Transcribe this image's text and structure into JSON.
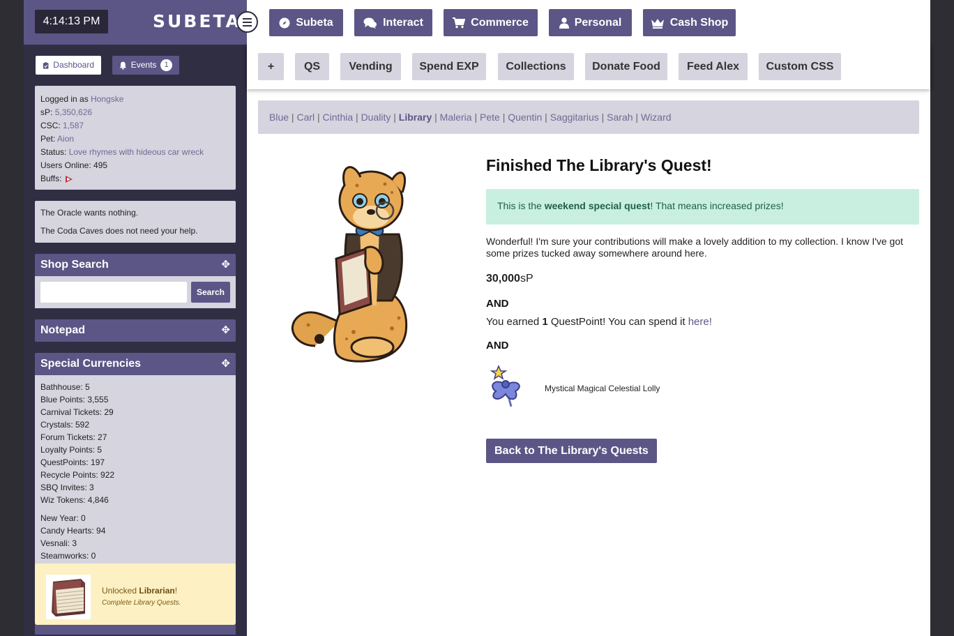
{
  "header": {
    "clock": "4:14:13 PM",
    "logo": "SUBETA"
  },
  "nav": {
    "items": [
      {
        "label": "Subeta",
        "icon": "compass-icon"
      },
      {
        "label": "Interact",
        "icon": "chat-bubbles-icon"
      },
      {
        "label": "Commerce",
        "icon": "cart-icon"
      },
      {
        "label": "Personal",
        "icon": "user-icon"
      },
      {
        "label": "Cash Shop",
        "icon": "crown-icon"
      }
    ]
  },
  "subnav": {
    "items": [
      "+",
      "QS",
      "Vending",
      "Spend EXP",
      "Collections",
      "Donate Food",
      "Feed Alex",
      "Custom CSS"
    ]
  },
  "breadcrumb": {
    "items": [
      "Blue",
      "Carl",
      "Cinthia",
      "Duality",
      "Library",
      "Maleria",
      "Pete",
      "Quentin",
      "Saggitarius",
      "Sarah",
      "Wizard"
    ],
    "active": "Library"
  },
  "sidebar": {
    "tabs": {
      "dashboard": "Dashboard",
      "events": "Events",
      "events_count": "1"
    },
    "user": {
      "logged_label": "Logged in as",
      "username": "Hongske",
      "sp_label": "sP:",
      "sp": "5,350,626",
      "csc_label": "CSC:",
      "csc": "1,587",
      "pet_label": "Pet:",
      "pet": "Aion",
      "status_label": "Status:",
      "status": "Love rhymes with hideous car wreck",
      "online": "Users Online: 495",
      "buffs_label": "Buffs:"
    },
    "oracle": {
      "line1": "The Oracle wants nothing.",
      "line2": "The Coda Caves does not need your help."
    },
    "shop_search": {
      "title": "Shop Search",
      "button": "Search",
      "placeholder": ""
    },
    "notepad": {
      "title": "Notepad"
    },
    "currencies": {
      "title": "Special Currencies",
      "group1": [
        "Bathhouse: 5",
        "Blue Points: 3,555",
        "Carnival Tickets: 29",
        "Crystals: 592",
        "Forum Tickets: 27",
        "Loyalty Points: 5",
        "QuestPoints: 197",
        "Recycle Points: 922",
        "SBQ Invites: 3",
        "Wiz Tokens: 4,846"
      ],
      "group2": [
        "New Year: 0",
        "Candy Hearts: 94",
        "Vesnali: 3",
        "Steamworks: 0"
      ]
    }
  },
  "toast": {
    "prefix": "Unlocked",
    "achievement": "Librarian",
    "suffix": "!",
    "description": "Complete Library Quests."
  },
  "quest": {
    "title": "Finished The Library's Quest!",
    "special_prefix": "This is the",
    "special_bold": "weekend special quest",
    "special_suffix": "! That means increased prizes!",
    "dialog": "Wonderful! I'm sure your contributions will make a lovely addition to my collection. I know I've got some prizes tucked away somewhere around here.",
    "sp_amount": "30,000",
    "sp_unit": "sP",
    "and": "AND",
    "qp_prefix": "You earned",
    "qp_count": "1",
    "qp_suffix": "QuestPoint! You can spend it",
    "qp_link": "here!",
    "item_name": "Mystical Magical Celestial Lolly",
    "back_button": "Back to The Library's Quests"
  },
  "colors": {
    "brand": "#5b5686",
    "sidebar_bg": "#302e43",
    "panel_bg": "#d5d4df",
    "success_bg": "#c8efe0",
    "toast_bg": "#fdf0c3"
  }
}
